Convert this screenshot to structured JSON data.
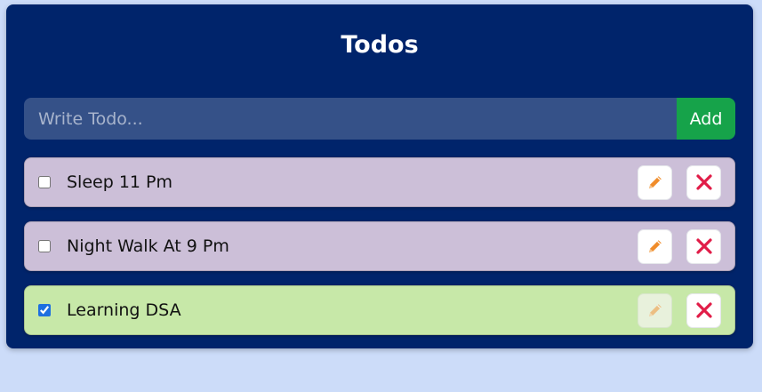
{
  "app": {
    "title": "Todos"
  },
  "input": {
    "placeholder": "Write Todo...",
    "value": "",
    "add_label": "Add"
  },
  "todos": [
    {
      "text": "Sleep 11 Pm",
      "completed": false
    },
    {
      "text": "Night Walk At 9 Pm",
      "completed": false
    },
    {
      "text": "Learning DSA",
      "completed": true
    }
  ],
  "colors": {
    "page_bg": "#ccdcf9",
    "panel_bg": "#00246b",
    "input_bg": "#355188",
    "add_button": "#16a34a",
    "todo_pending_bg": "#ccbfd8",
    "todo_done_bg": "#c7e8a8",
    "edit_icon": "#f08c2a",
    "delete_icon": "#e11d48"
  },
  "icons": {
    "edit": "pencil-icon",
    "delete": "close-icon"
  }
}
